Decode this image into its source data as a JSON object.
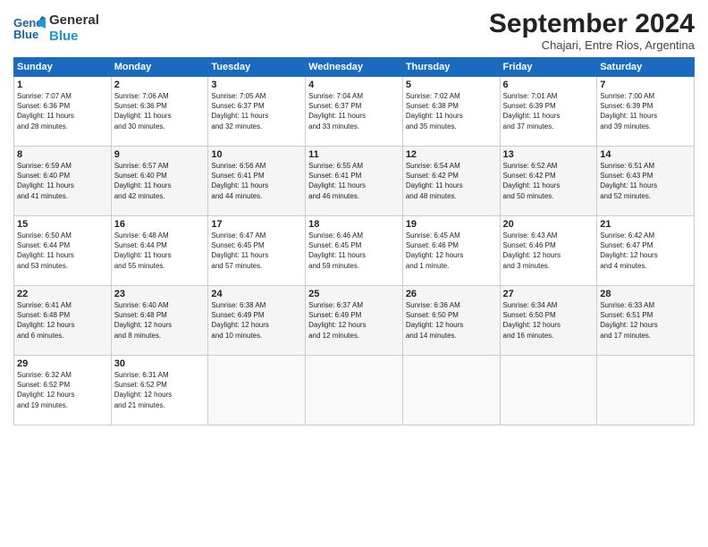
{
  "header": {
    "logo_line1": "General",
    "logo_line2": "Blue",
    "month": "September 2024",
    "location": "Chajari, Entre Rios, Argentina"
  },
  "weekdays": [
    "Sunday",
    "Monday",
    "Tuesday",
    "Wednesday",
    "Thursday",
    "Friday",
    "Saturday"
  ],
  "weeks": [
    [
      {
        "day": "1",
        "info": "Sunrise: 7:07 AM\nSunset: 6:36 PM\nDaylight: 11 hours\nand 28 minutes."
      },
      {
        "day": "2",
        "info": "Sunrise: 7:06 AM\nSunset: 6:36 PM\nDaylight: 11 hours\nand 30 minutes."
      },
      {
        "day": "3",
        "info": "Sunrise: 7:05 AM\nSunset: 6:37 PM\nDaylight: 11 hours\nand 32 minutes."
      },
      {
        "day": "4",
        "info": "Sunrise: 7:04 AM\nSunset: 6:37 PM\nDaylight: 11 hours\nand 33 minutes."
      },
      {
        "day": "5",
        "info": "Sunrise: 7:02 AM\nSunset: 6:38 PM\nDaylight: 11 hours\nand 35 minutes."
      },
      {
        "day": "6",
        "info": "Sunrise: 7:01 AM\nSunset: 6:39 PM\nDaylight: 11 hours\nand 37 minutes."
      },
      {
        "day": "7",
        "info": "Sunrise: 7:00 AM\nSunset: 6:39 PM\nDaylight: 11 hours\nand 39 minutes."
      }
    ],
    [
      {
        "day": "8",
        "info": "Sunrise: 6:59 AM\nSunset: 6:40 PM\nDaylight: 11 hours\nand 41 minutes."
      },
      {
        "day": "9",
        "info": "Sunrise: 6:57 AM\nSunset: 6:40 PM\nDaylight: 11 hours\nand 42 minutes."
      },
      {
        "day": "10",
        "info": "Sunrise: 6:56 AM\nSunset: 6:41 PM\nDaylight: 11 hours\nand 44 minutes."
      },
      {
        "day": "11",
        "info": "Sunrise: 6:55 AM\nSunset: 6:41 PM\nDaylight: 11 hours\nand 46 minutes."
      },
      {
        "day": "12",
        "info": "Sunrise: 6:54 AM\nSunset: 6:42 PM\nDaylight: 11 hours\nand 48 minutes."
      },
      {
        "day": "13",
        "info": "Sunrise: 6:52 AM\nSunset: 6:42 PM\nDaylight: 11 hours\nand 50 minutes."
      },
      {
        "day": "14",
        "info": "Sunrise: 6:51 AM\nSunset: 6:43 PM\nDaylight: 11 hours\nand 52 minutes."
      }
    ],
    [
      {
        "day": "15",
        "info": "Sunrise: 6:50 AM\nSunset: 6:44 PM\nDaylight: 11 hours\nand 53 minutes."
      },
      {
        "day": "16",
        "info": "Sunrise: 6:48 AM\nSunset: 6:44 PM\nDaylight: 11 hours\nand 55 minutes."
      },
      {
        "day": "17",
        "info": "Sunrise: 6:47 AM\nSunset: 6:45 PM\nDaylight: 11 hours\nand 57 minutes."
      },
      {
        "day": "18",
        "info": "Sunrise: 6:46 AM\nSunset: 6:45 PM\nDaylight: 11 hours\nand 59 minutes."
      },
      {
        "day": "19",
        "info": "Sunrise: 6:45 AM\nSunset: 6:46 PM\nDaylight: 12 hours\nand 1 minute."
      },
      {
        "day": "20",
        "info": "Sunrise: 6:43 AM\nSunset: 6:46 PM\nDaylight: 12 hours\nand 3 minutes."
      },
      {
        "day": "21",
        "info": "Sunrise: 6:42 AM\nSunset: 6:47 PM\nDaylight: 12 hours\nand 4 minutes."
      }
    ],
    [
      {
        "day": "22",
        "info": "Sunrise: 6:41 AM\nSunset: 6:48 PM\nDaylight: 12 hours\nand 6 minutes."
      },
      {
        "day": "23",
        "info": "Sunrise: 6:40 AM\nSunset: 6:48 PM\nDaylight: 12 hours\nand 8 minutes."
      },
      {
        "day": "24",
        "info": "Sunrise: 6:38 AM\nSunset: 6:49 PM\nDaylight: 12 hours\nand 10 minutes."
      },
      {
        "day": "25",
        "info": "Sunrise: 6:37 AM\nSunset: 6:49 PM\nDaylight: 12 hours\nand 12 minutes."
      },
      {
        "day": "26",
        "info": "Sunrise: 6:36 AM\nSunset: 6:50 PM\nDaylight: 12 hours\nand 14 minutes."
      },
      {
        "day": "27",
        "info": "Sunrise: 6:34 AM\nSunset: 6:50 PM\nDaylight: 12 hours\nand 16 minutes."
      },
      {
        "day": "28",
        "info": "Sunrise: 6:33 AM\nSunset: 6:51 PM\nDaylight: 12 hours\nand 17 minutes."
      }
    ],
    [
      {
        "day": "29",
        "info": "Sunrise: 6:32 AM\nSunset: 6:52 PM\nDaylight: 12 hours\nand 19 minutes."
      },
      {
        "day": "30",
        "info": "Sunrise: 6:31 AM\nSunset: 6:52 PM\nDaylight: 12 hours\nand 21 minutes."
      },
      null,
      null,
      null,
      null,
      null
    ]
  ]
}
